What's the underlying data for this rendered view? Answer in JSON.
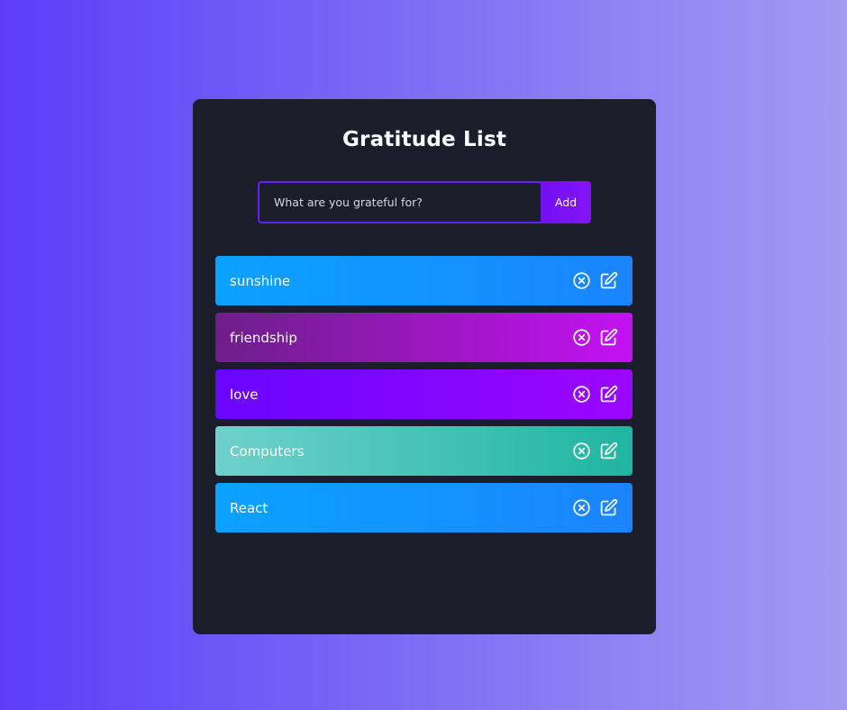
{
  "app": {
    "title": "Gratitude List"
  },
  "form": {
    "placeholder": "What are you grateful for?",
    "value": "",
    "add_label": "Add"
  },
  "items": [
    {
      "text": "sunshine",
      "gradient": [
        "#0aa2ff",
        "#1a84ff"
      ]
    },
    {
      "text": "friendship",
      "gradient": [
        "#6e1e8a",
        "#c411f2"
      ]
    },
    {
      "text": "love",
      "gradient": [
        "#6a05ff",
        "#9b06ff"
      ]
    },
    {
      "text": "Computers",
      "gradient": [
        "#6ed1ca",
        "#1fb5a1"
      ]
    },
    {
      "text": "React",
      "gradient": [
        "#0aa2ff",
        "#1a84ff"
      ]
    }
  ],
  "icons": {
    "delete": "close-circle-icon",
    "edit": "edit-icon"
  },
  "colors": {
    "card_bg": "#1b1d2a",
    "input_border": "#6e1cf2",
    "add_button": "#7a12f4",
    "background_start": "#5d3df9",
    "background_end": "#a19bf2"
  }
}
